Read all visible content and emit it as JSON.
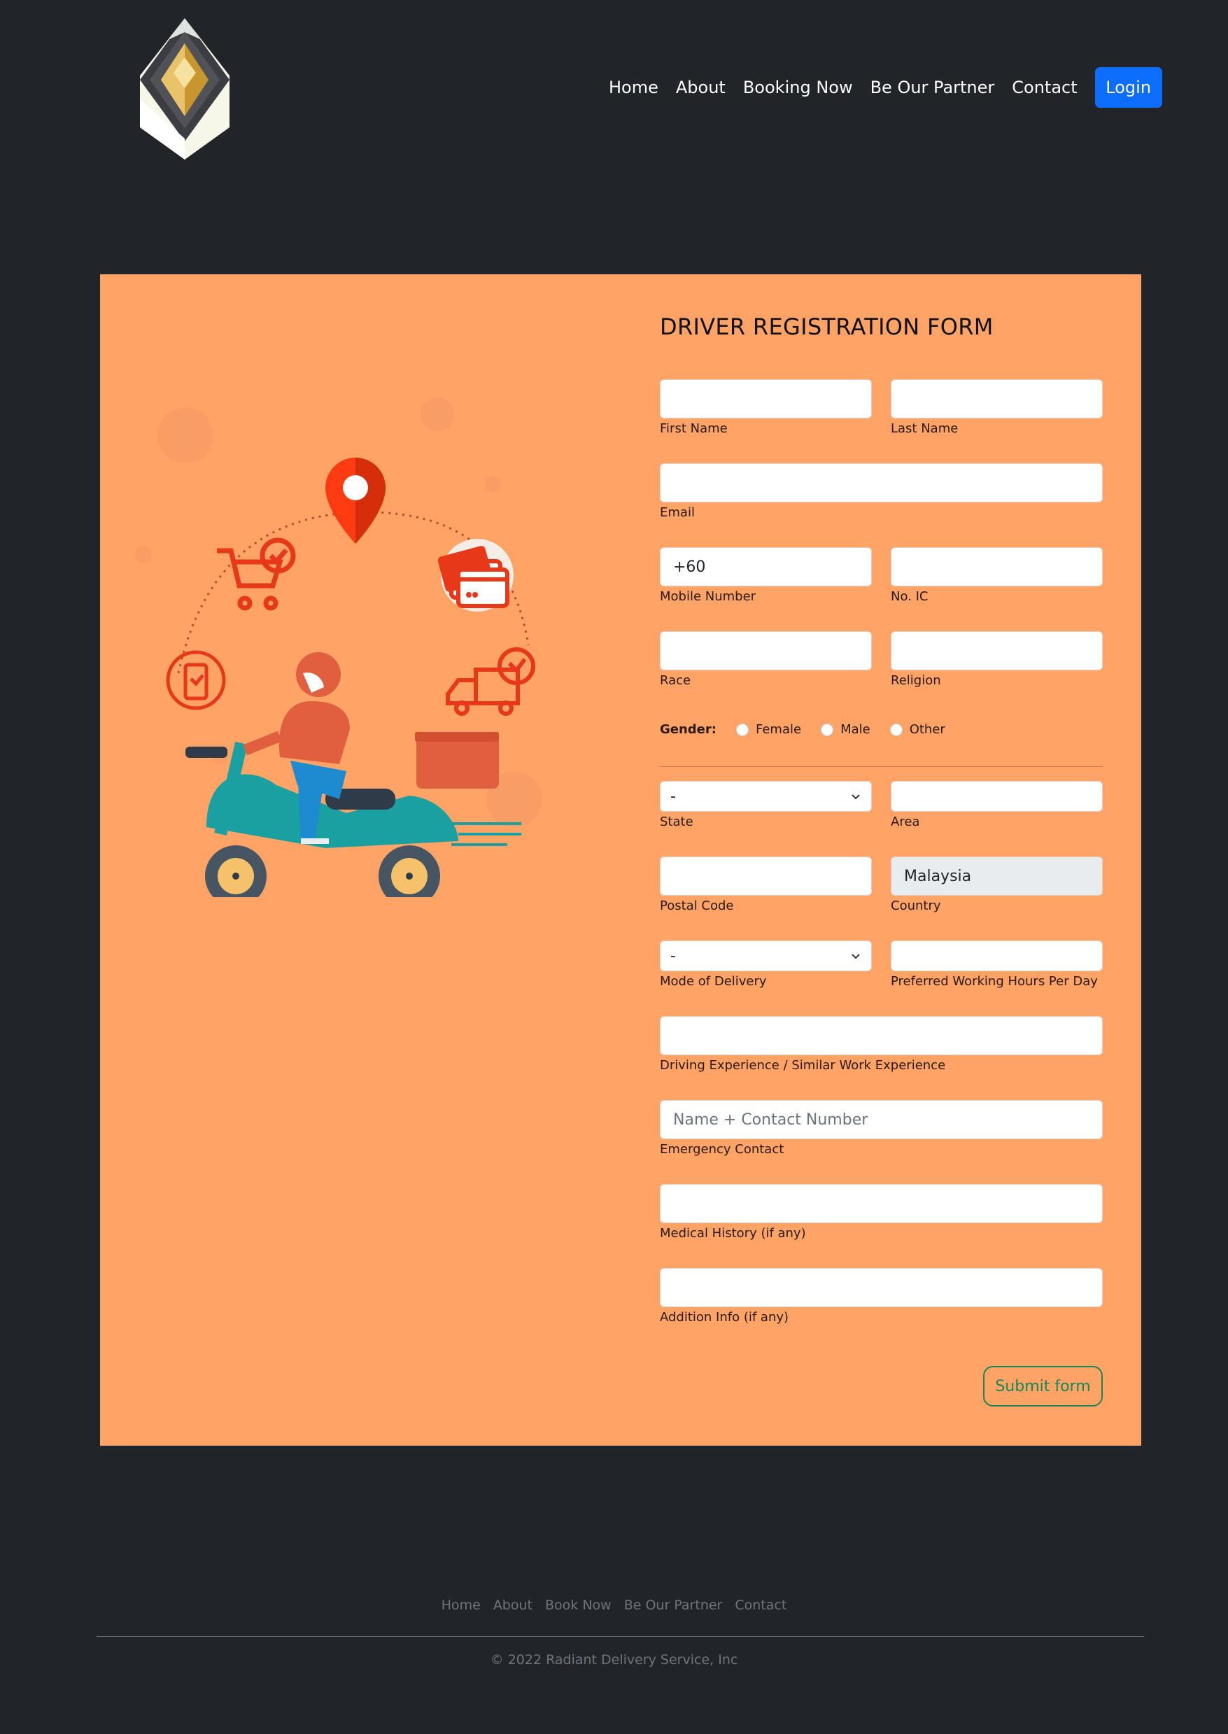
{
  "nav": {
    "items": [
      "Home",
      "About",
      "Booking Now",
      "Be Our Partner",
      "Contact"
    ],
    "login_label": "Login"
  },
  "form": {
    "title": "DRIVER REGISTRATION FORM",
    "first_name_label": "First Name",
    "last_name_label": "Last Name",
    "email_label": "Email",
    "mobile_value": "+60",
    "mobile_label": "Mobile Number",
    "ic_label": "No. IC",
    "race_label": "Race",
    "religion_label": "Religion",
    "gender_label": "Gender:",
    "gender_options": [
      "Female",
      "Male",
      "Other"
    ],
    "state_value": "-",
    "state_label": "State",
    "area_label": "Area",
    "postal_label": "Postal Code",
    "country_value": "Malaysia",
    "country_label": "Country",
    "delivery_value": "-",
    "delivery_label": "Mode of Delivery",
    "hours_label": "Preferred Working Hours Per Day",
    "experience_label": "Driving Experience / Similar Work Experience",
    "emergency_placeholder": "Name + Contact Number",
    "emergency_label": "Emergency Contact",
    "medical_label": "Medical History (if any)",
    "addition_label": "Addition Info (if any)",
    "submit_label": "Submit form"
  },
  "footer": {
    "links": [
      "Home",
      "About",
      "Book Now",
      "Be Our Partner",
      "Contact"
    ],
    "copyright": "© 2022 Radiant Delivery Service, Inc"
  },
  "colors": {
    "background": "#212529",
    "panel": "#ffa366",
    "login": "#0d6efd",
    "submit": "#198754"
  }
}
